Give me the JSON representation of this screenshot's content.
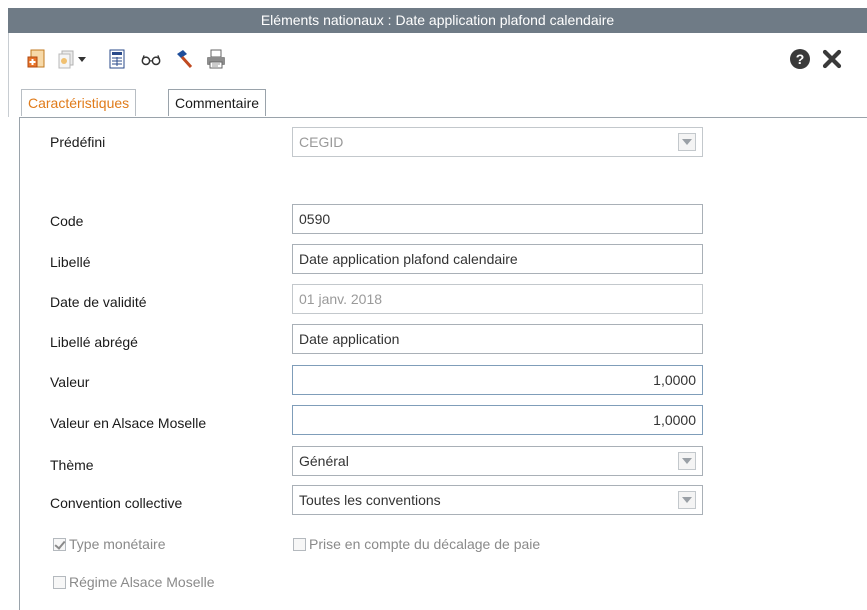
{
  "window": {
    "title": "Eléments nationaux : Date application plafond calendaire"
  },
  "toolbar": {
    "icons": [
      "new-document-icon",
      "copy-icon",
      "dropdown-arrow-icon",
      "calculator-icon",
      "glasses-icon",
      "hammer-icon",
      "print-icon",
      "help-icon",
      "close-icon"
    ]
  },
  "tabs": [
    {
      "label": "Caractéristiques",
      "active": true
    },
    {
      "label": "Commentaire",
      "active": false
    }
  ],
  "form": {
    "predefini": {
      "label": "Prédéfini",
      "value": "CEGID"
    },
    "code": {
      "label": "Code",
      "value": "0590"
    },
    "libelle": {
      "label": "Libellé",
      "value": "Date application plafond calendaire"
    },
    "date_validite": {
      "label": "Date de validité",
      "value": "01 janv. 2018"
    },
    "libelle_abrege": {
      "label": "Libellé abrégé",
      "value": "Date application"
    },
    "valeur": {
      "label": "Valeur",
      "value": "1,0000"
    },
    "valeur_alsace": {
      "label": "Valeur en Alsace Moselle",
      "value": "1,0000"
    },
    "theme": {
      "label": "Thème",
      "value": "Général"
    },
    "convention": {
      "label": "Convention collective",
      "value": "Toutes les conventions"
    }
  },
  "checkboxes": {
    "type_monetaire": {
      "label": "Type monétaire",
      "checked": true
    },
    "prise_en_compte": {
      "label": "Prise en compte du décalage de paie",
      "checked": false
    },
    "regime_alsace": {
      "label": "Régime Alsace Moselle",
      "checked": false
    }
  },
  "colors": {
    "titlebar": "#6f7b86",
    "active_tab": "#e07b1a",
    "help": "#3a3a3a"
  }
}
